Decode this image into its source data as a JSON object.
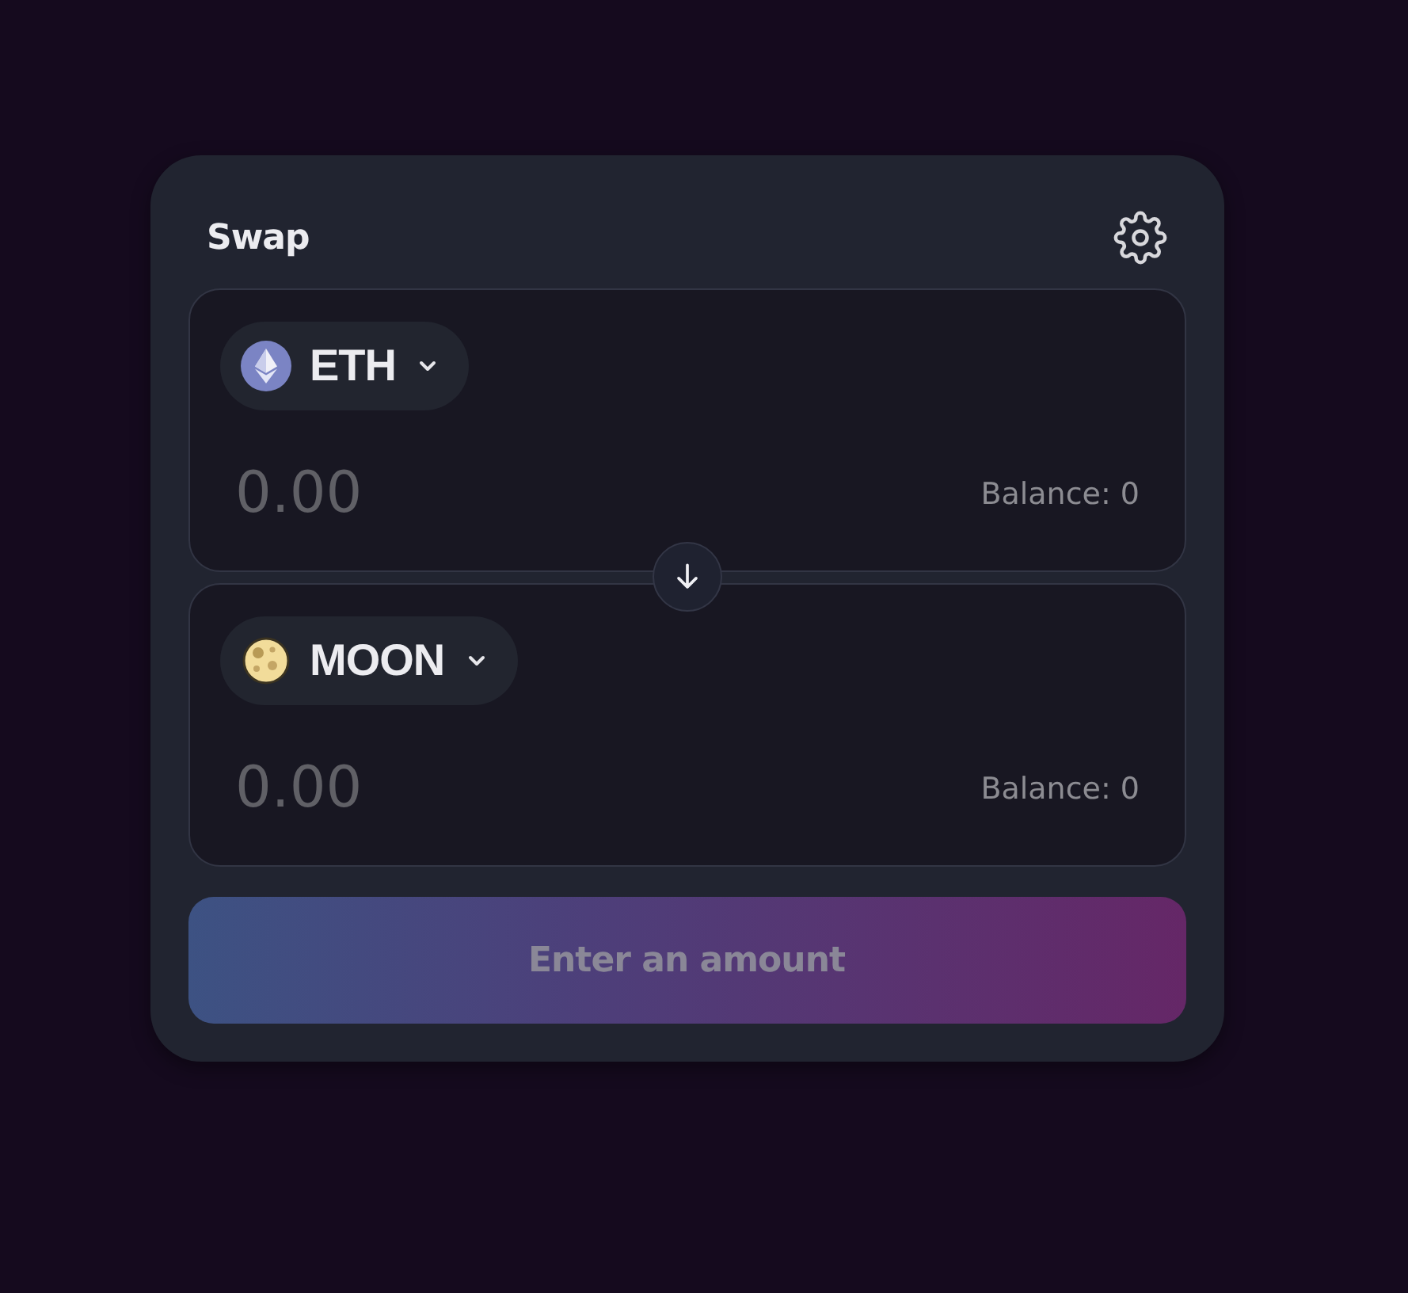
{
  "title": "Swap",
  "panels": [
    {
      "token": "ETH",
      "kind": "eth",
      "placeholder": "0.00",
      "balance": "Balance: 0"
    },
    {
      "token": "MOON",
      "kind": "moon",
      "placeholder": "0.00",
      "balance": "Balance: 0"
    }
  ],
  "submit": {
    "label": "Enter an amount",
    "disabled": true
  }
}
